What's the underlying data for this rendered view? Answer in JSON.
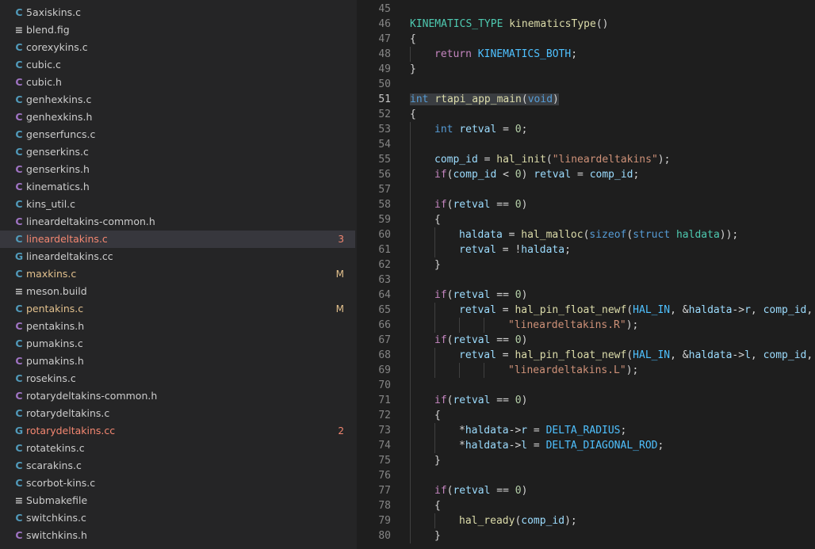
{
  "colors": {
    "c_file_icon": "#519aba",
    "h_file_icon": "#a074c4",
    "cc_file_icon": "#519aba",
    "plain_icon": "#cccccc",
    "error_text": "#f48771",
    "modified_text": "#e2c08d"
  },
  "explorer": {
    "files": [
      {
        "name": "5axiskins.c",
        "icon": "C",
        "kind": "c-file-icon",
        "status": ""
      },
      {
        "name": "blend.fig",
        "icon": "≡",
        "kind": "text-file-icon",
        "status": ""
      },
      {
        "name": "corexykins.c",
        "icon": "C",
        "kind": "c-file-icon",
        "status": ""
      },
      {
        "name": "cubic.c",
        "icon": "C",
        "kind": "c-file-icon",
        "status": ""
      },
      {
        "name": "cubic.h",
        "icon": "C",
        "kind": "h-file-icon",
        "status": ""
      },
      {
        "name": "genhexkins.c",
        "icon": "C",
        "kind": "c-file-icon",
        "status": ""
      },
      {
        "name": "genhexkins.h",
        "icon": "C",
        "kind": "h-file-icon",
        "status": ""
      },
      {
        "name": "genserfuncs.c",
        "icon": "C",
        "kind": "c-file-icon",
        "status": ""
      },
      {
        "name": "genserkins.c",
        "icon": "C",
        "kind": "c-file-icon",
        "status": ""
      },
      {
        "name": "genserkins.h",
        "icon": "C",
        "kind": "h-file-icon",
        "status": ""
      },
      {
        "name": "kinematics.h",
        "icon": "C",
        "kind": "h-file-icon",
        "status": ""
      },
      {
        "name": "kins_util.c",
        "icon": "C",
        "kind": "c-file-icon",
        "status": ""
      },
      {
        "name": "lineardeltakins-common.h",
        "icon": "C",
        "kind": "h-file-icon",
        "status": ""
      },
      {
        "name": "lineardeltakins.c",
        "icon": "C",
        "kind": "c-file-icon",
        "status": "error",
        "badge": "3",
        "selected": true
      },
      {
        "name": "lineardeltakins.cc",
        "icon": "G",
        "kind": "cpp-file-icon",
        "status": ""
      },
      {
        "name": "maxkins.c",
        "icon": "C",
        "kind": "c-file-icon",
        "status": "modified",
        "badge": "M"
      },
      {
        "name": "meson.build",
        "icon": "≡",
        "kind": "text-file-icon",
        "status": ""
      },
      {
        "name": "pentakins.c",
        "icon": "C",
        "kind": "c-file-icon",
        "status": "modified",
        "badge": "M"
      },
      {
        "name": "pentakins.h",
        "icon": "C",
        "kind": "h-file-icon",
        "status": ""
      },
      {
        "name": "pumakins.c",
        "icon": "C",
        "kind": "c-file-icon",
        "status": ""
      },
      {
        "name": "pumakins.h",
        "icon": "C",
        "kind": "h-file-icon",
        "status": ""
      },
      {
        "name": "rosekins.c",
        "icon": "C",
        "kind": "c-file-icon",
        "status": ""
      },
      {
        "name": "rotarydeltakins-common.h",
        "icon": "C",
        "kind": "h-file-icon",
        "status": ""
      },
      {
        "name": "rotarydeltakins.c",
        "icon": "C",
        "kind": "c-file-icon",
        "status": ""
      },
      {
        "name": "rotarydeltakins.cc",
        "icon": "G",
        "kind": "cpp-file-icon",
        "status": "error",
        "badge": "2"
      },
      {
        "name": "rotatekins.c",
        "icon": "C",
        "kind": "c-file-icon",
        "status": ""
      },
      {
        "name": "scarakins.c",
        "icon": "C",
        "kind": "c-file-icon",
        "status": ""
      },
      {
        "name": "scorbot-kins.c",
        "icon": "C",
        "kind": "c-file-icon",
        "status": ""
      },
      {
        "name": "Submakefile",
        "icon": "≡",
        "kind": "text-file-icon",
        "status": ""
      },
      {
        "name": "switchkins.c",
        "icon": "C",
        "kind": "c-file-icon",
        "status": ""
      },
      {
        "name": "switchkins.h",
        "icon": "C",
        "kind": "h-file-icon",
        "status": ""
      }
    ]
  },
  "editor": {
    "active_line": 51,
    "lines": [
      {
        "n": "45",
        "indent": 0,
        "tokens": []
      },
      {
        "n": "46",
        "indent": 0,
        "tokens": [
          [
            "KINEMATICS_TYPE",
            "type"
          ],
          [
            " ",
            "plain"
          ],
          [
            "kinematicsType",
            "fn"
          ],
          [
            "()",
            "plain"
          ]
        ]
      },
      {
        "n": "47",
        "indent": 0,
        "tokens": [
          [
            "{",
            "plain"
          ]
        ]
      },
      {
        "n": "48",
        "indent": 1,
        "tokens": [
          [
            "return",
            "ctrl"
          ],
          [
            " ",
            "plain"
          ],
          [
            "KINEMATICS_BOTH",
            "mac"
          ],
          [
            ";",
            "plain"
          ]
        ]
      },
      {
        "n": "49",
        "indent": 0,
        "tokens": [
          [
            "}",
            "plain"
          ]
        ]
      },
      {
        "n": "50",
        "indent": 0,
        "tokens": []
      },
      {
        "n": "51",
        "indent": 0,
        "tokens": [
          [
            "int",
            "kw"
          ],
          [
            " ",
            "plain"
          ],
          [
            "rtapi_app_main",
            "fn"
          ],
          [
            "(",
            "plain"
          ],
          [
            "void",
            "kw"
          ],
          [
            ")",
            "plain"
          ]
        ],
        "highlight": true
      },
      {
        "n": "52",
        "indent": 0,
        "tokens": [
          [
            "{",
            "plain"
          ]
        ]
      },
      {
        "n": "53",
        "indent": 1,
        "tokens": [
          [
            "int",
            "kw"
          ],
          [
            " ",
            "plain"
          ],
          [
            "retval",
            "var"
          ],
          [
            " = ",
            "plain"
          ],
          [
            "0",
            "num"
          ],
          [
            ";",
            "plain"
          ]
        ]
      },
      {
        "n": "54",
        "indent": 1,
        "tokens": []
      },
      {
        "n": "55",
        "indent": 1,
        "tokens": [
          [
            "comp_id",
            "var"
          ],
          [
            " = ",
            "plain"
          ],
          [
            "hal_init",
            "fn"
          ],
          [
            "(",
            "plain"
          ],
          [
            "\"lineardeltakins\"",
            "str"
          ],
          [
            ");",
            "plain"
          ]
        ]
      },
      {
        "n": "56",
        "indent": 1,
        "tokens": [
          [
            "if",
            "ctrl"
          ],
          [
            "(",
            "plain"
          ],
          [
            "comp_id",
            "var"
          ],
          [
            " < ",
            "plain"
          ],
          [
            "0",
            "num"
          ],
          [
            ") ",
            "plain"
          ],
          [
            "retval",
            "var"
          ],
          [
            " = ",
            "plain"
          ],
          [
            "comp_id",
            "var"
          ],
          [
            ";",
            "plain"
          ]
        ]
      },
      {
        "n": "57",
        "indent": 1,
        "tokens": []
      },
      {
        "n": "58",
        "indent": 1,
        "tokens": [
          [
            "if",
            "ctrl"
          ],
          [
            "(",
            "plain"
          ],
          [
            "retval",
            "var"
          ],
          [
            " == ",
            "plain"
          ],
          [
            "0",
            "num"
          ],
          [
            ")",
            "plain"
          ]
        ]
      },
      {
        "n": "59",
        "indent": 1,
        "tokens": [
          [
            "{",
            "plain"
          ]
        ]
      },
      {
        "n": "60",
        "indent": 2,
        "tokens": [
          [
            "haldata",
            "var"
          ],
          [
            " = ",
            "plain"
          ],
          [
            "hal_malloc",
            "fn"
          ],
          [
            "(",
            "plain"
          ],
          [
            "sizeof",
            "kw"
          ],
          [
            "(",
            "plain"
          ],
          [
            "struct",
            "kw"
          ],
          [
            " ",
            "plain"
          ],
          [
            "haldata",
            "type"
          ],
          [
            "));",
            "plain"
          ]
        ]
      },
      {
        "n": "61",
        "indent": 2,
        "tokens": [
          [
            "retval",
            "var"
          ],
          [
            " = !",
            "plain"
          ],
          [
            "haldata",
            "var"
          ],
          [
            ";",
            "plain"
          ]
        ]
      },
      {
        "n": "62",
        "indent": 1,
        "tokens": [
          [
            "}",
            "plain"
          ]
        ]
      },
      {
        "n": "63",
        "indent": 1,
        "tokens": []
      },
      {
        "n": "64",
        "indent": 1,
        "tokens": [
          [
            "if",
            "ctrl"
          ],
          [
            "(",
            "plain"
          ],
          [
            "retval",
            "var"
          ],
          [
            " == ",
            "plain"
          ],
          [
            "0",
            "num"
          ],
          [
            ")",
            "plain"
          ]
        ]
      },
      {
        "n": "65",
        "indent": 2,
        "tokens": [
          [
            "retval",
            "var"
          ],
          [
            " = ",
            "plain"
          ],
          [
            "hal_pin_float_newf",
            "fn"
          ],
          [
            "(",
            "plain"
          ],
          [
            "HAL_IN",
            "mac"
          ],
          [
            ", &",
            "plain"
          ],
          [
            "haldata",
            "var"
          ],
          [
            "->",
            "plain"
          ],
          [
            "r",
            "var"
          ],
          [
            ", ",
            "plain"
          ],
          [
            "comp_id",
            "var"
          ],
          [
            ",",
            "plain"
          ]
        ]
      },
      {
        "n": "66",
        "indent": 4,
        "tokens": [
          [
            "\"lineardeltakins.R\"",
            "str"
          ],
          [
            ");",
            "plain"
          ]
        ]
      },
      {
        "n": "67",
        "indent": 1,
        "tokens": [
          [
            "if",
            "ctrl"
          ],
          [
            "(",
            "plain"
          ],
          [
            "retval",
            "var"
          ],
          [
            " == ",
            "plain"
          ],
          [
            "0",
            "num"
          ],
          [
            ")",
            "plain"
          ]
        ]
      },
      {
        "n": "68",
        "indent": 2,
        "tokens": [
          [
            "retval",
            "var"
          ],
          [
            " = ",
            "plain"
          ],
          [
            "hal_pin_float_newf",
            "fn"
          ],
          [
            "(",
            "plain"
          ],
          [
            "HAL_IN",
            "mac"
          ],
          [
            ", &",
            "plain"
          ],
          [
            "haldata",
            "var"
          ],
          [
            "->",
            "plain"
          ],
          [
            "l",
            "var"
          ],
          [
            ", ",
            "plain"
          ],
          [
            "comp_id",
            "var"
          ],
          [
            ",",
            "plain"
          ]
        ]
      },
      {
        "n": "69",
        "indent": 4,
        "tokens": [
          [
            "\"lineardeltakins.L\"",
            "str"
          ],
          [
            ");",
            "plain"
          ]
        ]
      },
      {
        "n": "70",
        "indent": 1,
        "tokens": []
      },
      {
        "n": "71",
        "indent": 1,
        "tokens": [
          [
            "if",
            "ctrl"
          ],
          [
            "(",
            "plain"
          ],
          [
            "retval",
            "var"
          ],
          [
            " == ",
            "plain"
          ],
          [
            "0",
            "num"
          ],
          [
            ")",
            "plain"
          ]
        ]
      },
      {
        "n": "72",
        "indent": 1,
        "tokens": [
          [
            "{",
            "plain"
          ]
        ]
      },
      {
        "n": "73",
        "indent": 2,
        "tokens": [
          [
            "*",
            "plain"
          ],
          [
            "haldata",
            "var"
          ],
          [
            "->",
            "plain"
          ],
          [
            "r",
            "var"
          ],
          [
            " = ",
            "plain"
          ],
          [
            "DELTA_RADIUS",
            "mac"
          ],
          [
            ";",
            "plain"
          ]
        ]
      },
      {
        "n": "74",
        "indent": 2,
        "tokens": [
          [
            "*",
            "plain"
          ],
          [
            "haldata",
            "var"
          ],
          [
            "->",
            "plain"
          ],
          [
            "l",
            "var"
          ],
          [
            " = ",
            "plain"
          ],
          [
            "DELTA_DIAGONAL_ROD",
            "mac"
          ],
          [
            ";",
            "plain"
          ]
        ]
      },
      {
        "n": "75",
        "indent": 1,
        "tokens": [
          [
            "}",
            "plain"
          ]
        ]
      },
      {
        "n": "76",
        "indent": 1,
        "tokens": []
      },
      {
        "n": "77",
        "indent": 1,
        "tokens": [
          [
            "if",
            "ctrl"
          ],
          [
            "(",
            "plain"
          ],
          [
            "retval",
            "var"
          ],
          [
            " == ",
            "plain"
          ],
          [
            "0",
            "num"
          ],
          [
            ")",
            "plain"
          ]
        ]
      },
      {
        "n": "78",
        "indent": 1,
        "tokens": [
          [
            "{",
            "plain"
          ]
        ]
      },
      {
        "n": "79",
        "indent": 2,
        "tokens": [
          [
            "hal_ready",
            "fn"
          ],
          [
            "(",
            "plain"
          ],
          [
            "comp_id",
            "var"
          ],
          [
            ");",
            "plain"
          ]
        ]
      },
      {
        "n": "80",
        "indent": 1,
        "tokens": [
          [
            "}",
            "plain"
          ]
        ]
      }
    ]
  }
}
